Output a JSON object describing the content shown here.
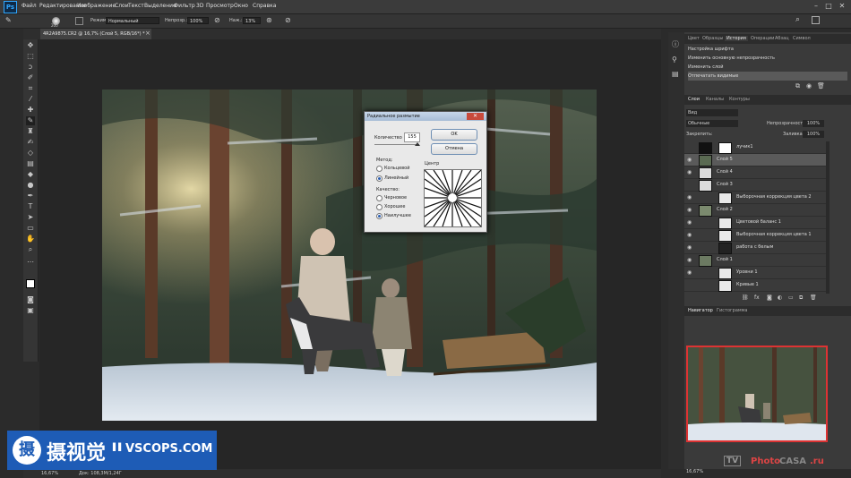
{
  "app": {
    "logo": "Ps"
  },
  "menubar": {
    "items": [
      "Файл",
      "Редактирование",
      "Изображение",
      "Слои",
      "Текст",
      "Выделение",
      "Фильтр",
      "3D",
      "Просмотр",
      "Окно",
      "Справка"
    ],
    "window_controls": [
      "–",
      "□",
      "✕"
    ]
  },
  "options": {
    "brush_size": "200",
    "mode_label": "Режим:",
    "mode_value": "Нормальный",
    "opacity_label": "Непрозр.:",
    "opacity_value": "100%",
    "flow_label": "Наж.:",
    "flow_value": "13%"
  },
  "document": {
    "tab_title": "4R2A9875.CR2 @ 16,7% (Слой 5, RGB/16*) *"
  },
  "toolbar": {
    "tools": [
      "move-icon",
      "marquee-icon",
      "lasso-icon",
      "quick-select-icon",
      "crop-icon",
      "eyedropper-icon",
      "healing-icon",
      "brush-icon",
      "stamp-icon",
      "history-brush-icon",
      "eraser-icon",
      "gradient-icon",
      "blur-icon",
      "dodge-icon",
      "pen-icon",
      "type-icon",
      "path-select-icon",
      "shape-icon",
      "hand-icon",
      "zoom-icon"
    ]
  },
  "dialog": {
    "title": "Радиальное размытие",
    "amount_label": "Количество",
    "amount_value": "155",
    "ok_label": "OK",
    "cancel_label": "Отмена",
    "method_label": "Метод:",
    "method_options": [
      "Кольцевой",
      "Линейный"
    ],
    "method_selected": 1,
    "quality_label": "Качество:",
    "quality_options": [
      "Черновое",
      "Хорошее",
      "Наилучшее"
    ],
    "quality_selected": 2,
    "center_label": "Центр"
  },
  "panels": {
    "top_tabs": [
      "Цвет",
      "Образцы",
      "История",
      "Операции",
      "Абзац",
      "Символ"
    ],
    "active_top_tab": 2,
    "history_items": [
      "Настройка шрифта",
      "Изменить основную непрозрачность",
      "Изменить слой",
      "Отпечатать видимые"
    ],
    "layers_tabs": [
      "Слои",
      "Каналы",
      "Контуры"
    ],
    "layer_kind": "Вид",
    "blend_mode": "Обычные",
    "opacity_label": "Непрозрачность:",
    "opacity_value": "100%",
    "lock_label": "Закрепить:",
    "fill_label": "Заливка:",
    "fill_value": "100%",
    "layers": [
      {
        "name": "лучик1",
        "thumb": "#111",
        "mask": true
      },
      {
        "name": "Слой 5",
        "thumb": "#5a6a52",
        "mask": false
      },
      {
        "name": "Слой 4",
        "thumb": "#dcdcdc",
        "mask": false
      },
      {
        "name": "Слой 3",
        "thumb": "#dcdcdc",
        "mask": false
      },
      {
        "name": "Выборочная коррекция цвета 2",
        "thumb": "#e8e8e8",
        "mask": true
      },
      {
        "name": "Слой 2",
        "thumb": "#7b8a6e",
        "mask": false
      },
      {
        "name": "Цветовой баланс 1",
        "thumb": "#e8e8e8",
        "mask": true
      },
      {
        "name": "Выборочная коррекция цвета 1",
        "thumb": "#e8e8e8",
        "mask": true
      },
      {
        "name": "работа с белым",
        "thumb": "#222",
        "mask": true
      },
      {
        "name": "Слой 1",
        "thumb": "#6c7a62",
        "mask": false
      },
      {
        "name": "Уровни 1",
        "thumb": "#e8e8e8",
        "mask": true
      },
      {
        "name": "Кривые 1",
        "thumb": "#e8e8e8",
        "mask": true
      }
    ],
    "navigator_tabs": [
      "Навигатор",
      "Гистограмма"
    ],
    "navigator_zoom": "16,67%"
  },
  "status": {
    "zoom": "16,67%",
    "doc_size": "Док: 108,3M/1,24Г"
  },
  "watermark": {
    "text1": "摄视觉",
    "text2": "VSCOPS.COM",
    "logo_char": "摄"
  },
  "corner_badge": {
    "tv": "TV",
    "photo": "Photo",
    "casa": "CASA",
    "ru": ".ru"
  }
}
